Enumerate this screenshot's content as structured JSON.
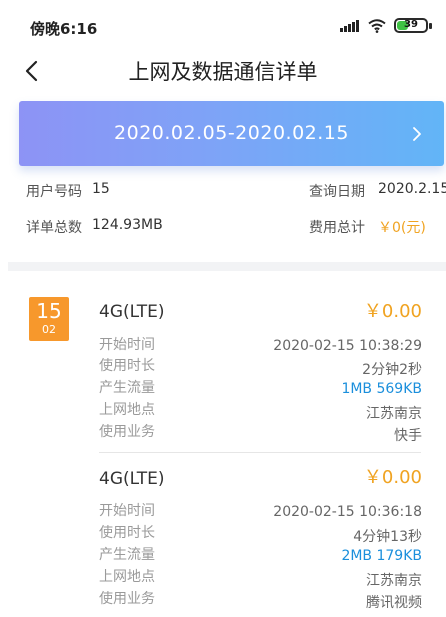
{
  "status_bar": {
    "time": "傍晚6:16",
    "battery_level": "39",
    "battery_fraction": 0.39
  },
  "header": {
    "title": "上网及数据通信详单"
  },
  "date_range": {
    "label": "2020.02.05-2020.02.15"
  },
  "summary": {
    "user_number_label": "用户号码",
    "user_number_value": "15",
    "query_date_label": "查询日期",
    "query_date_value": "2020.2.15",
    "total_records_label": "详单总数",
    "total_records_value": "124.93MB",
    "total_fee_label": "费用总计",
    "total_fee_value": "￥0(元)"
  },
  "day_badge": {
    "day": "15",
    "month": "02"
  },
  "field_labels": {
    "start_time": "开始时间",
    "duration": "使用时长",
    "data_usage": "产生流量",
    "location": "上网地点",
    "service": "使用业务"
  },
  "records": [
    {
      "type": "4G(LTE)",
      "fee": "￥0.00",
      "start_time": "2020-02-15 10:38:29",
      "duration": "2分钟2秒",
      "data_usage": "1MB 569KB",
      "location": "江苏南京",
      "service": "快手"
    },
    {
      "type": "4G(LTE)",
      "fee": "￥0.00",
      "start_time": "2020-02-15 10:36:18",
      "duration": "4分钟13秒",
      "data_usage": "2MB 179KB",
      "location": "江苏南京",
      "service": "腾讯视频"
    }
  ],
  "colors": {
    "accent_orange": "#f0a321",
    "badge_orange": "#f7982c",
    "data_blue": "#1b8fdc",
    "banner_start": "#8d93f5",
    "banner_end": "#62b5f7"
  }
}
